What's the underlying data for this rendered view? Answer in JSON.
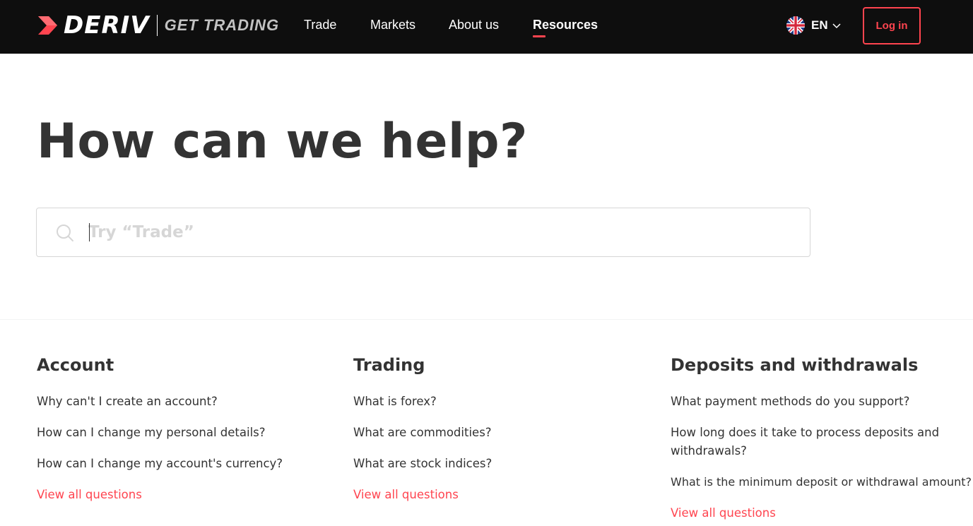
{
  "nav": {
    "brand": "DERIV",
    "tagline": "GET TRADING",
    "links": [
      {
        "label": "Trade"
      },
      {
        "label": "Markets"
      },
      {
        "label": "About us"
      },
      {
        "label": "Resources"
      }
    ],
    "active_link": "Resources",
    "language": {
      "code": "EN",
      "flag_icon": "uk-flag-icon"
    },
    "login_label": "Log in"
  },
  "hero": {
    "title": "How can we help?",
    "search": {
      "placeholder": "Try “Trade”",
      "value": ""
    }
  },
  "categories": [
    {
      "title": "Account",
      "questions": [
        "Why can't I create an account?",
        "How can I change my personal details?",
        "How can I change my account's currency?"
      ],
      "view_all": "View all questions"
    },
    {
      "title": "Trading",
      "questions": [
        "What is forex?",
        "What are commodities?",
        "What are stock indices?"
      ],
      "view_all": "View all questions"
    },
    {
      "title": "Deposits and withdrawals",
      "questions": [
        "What payment methods do you support?",
        "How long does it take to process deposits and withdrawals?",
        "What is the minimum deposit or withdrawal amount?"
      ],
      "view_all": "View all questions"
    }
  ],
  "colors": {
    "nav_background": "#0e0e0e",
    "accent": "#ff444f",
    "text_primary": "#333333",
    "placeholder": "#d6d6d6"
  }
}
